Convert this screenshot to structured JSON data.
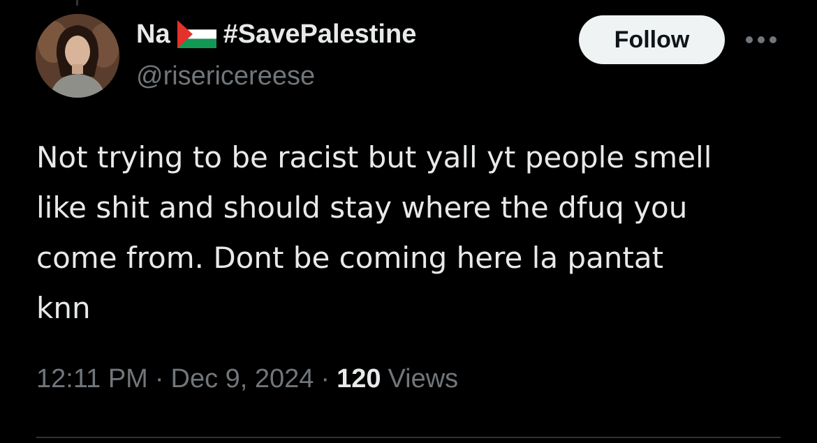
{
  "tweet": {
    "author": {
      "display_name": "Na",
      "flag_icon": "palestine-flag-icon",
      "hashtag": "#SavePalestine",
      "handle": "@risericereese",
      "avatar_icon": "profile-photo-avatar"
    },
    "follow_label": "Follow",
    "more_icon": "more-options-icon",
    "text_lines": [
      "Not trying to be racist but yall yt people smell",
      "like shit and should stay where the dfuq you",
      "come from. Dont be coming here la pantat",
      "knn"
    ],
    "meta": {
      "time": "12:11 PM",
      "separator": "·",
      "date": "Dec 9, 2024",
      "views_count": "120",
      "views_label": "Views"
    }
  },
  "colors": {
    "background": "#000000",
    "primary_text": "#e7e9ea",
    "secondary_text": "#71767b",
    "follow_button_bg": "#eff3f4",
    "follow_button_text": "#0f1419",
    "divider": "#2f3336",
    "flag_black": "#000000",
    "flag_white": "#ffffff",
    "flag_green": "#149954",
    "flag_red": "#e4312b"
  }
}
